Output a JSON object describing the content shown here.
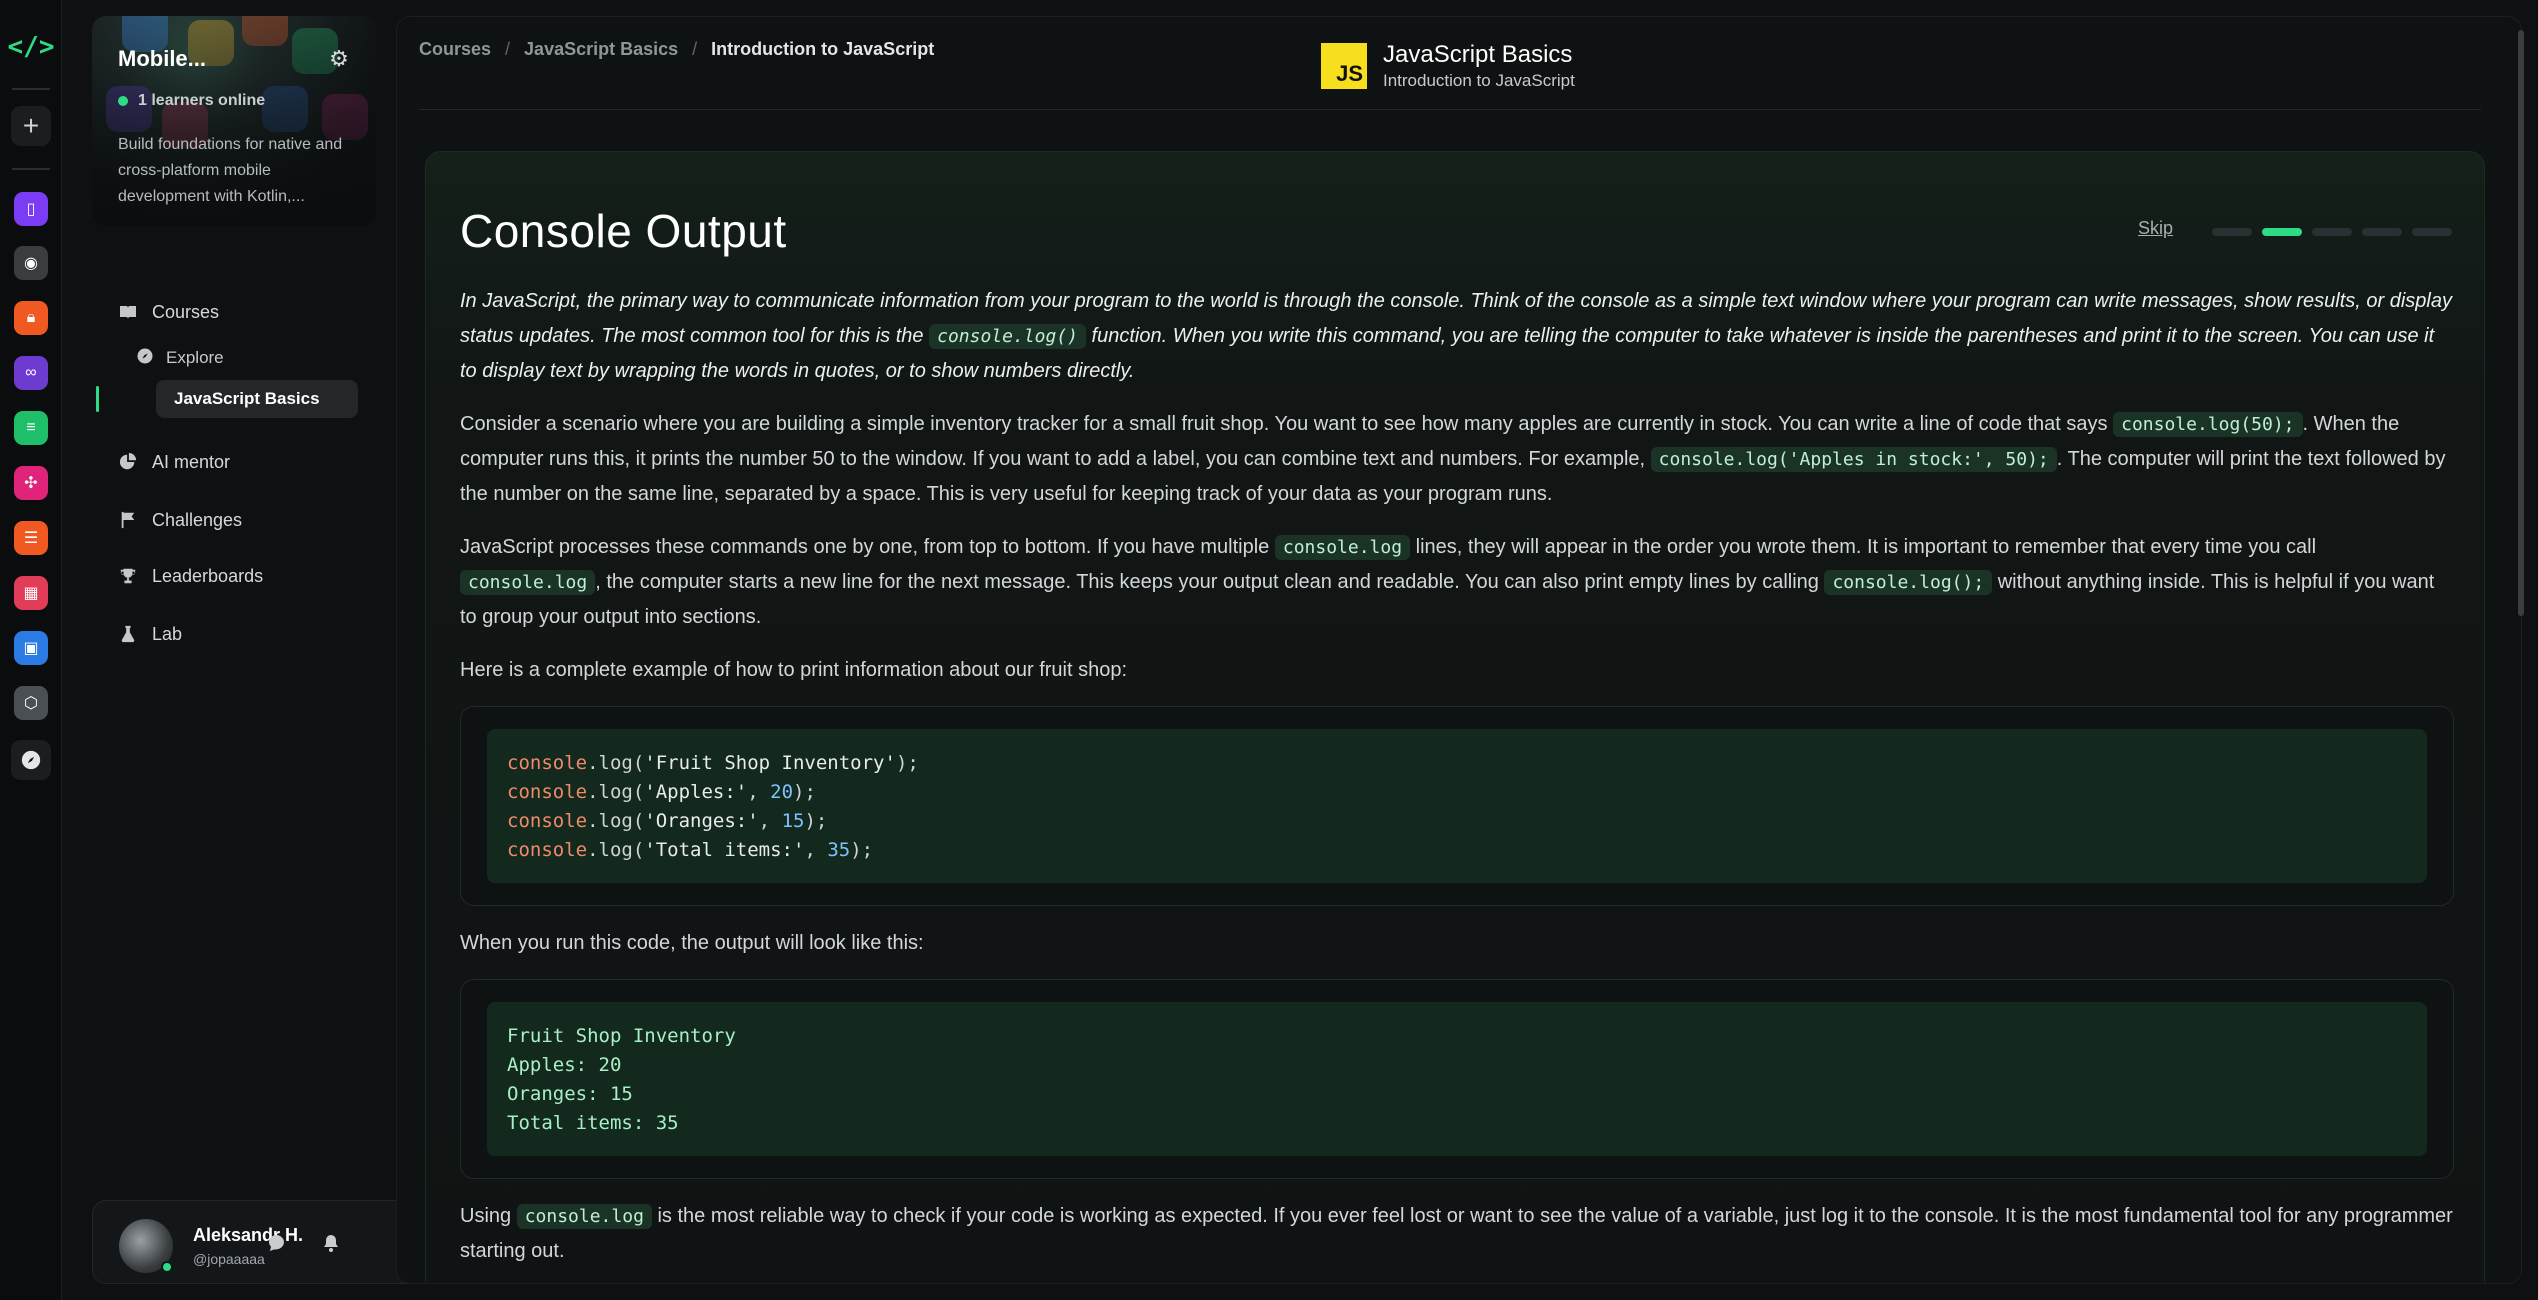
{
  "colors": {
    "accent": "#2fdc86",
    "js_badge": "#f7df1e"
  },
  "rail": {
    "icons": [
      "code-logo-icon",
      "plus-icon",
      "compass-icon"
    ],
    "apps": [
      {
        "name": "app-mobile",
        "color": "#7b3cf5"
      },
      {
        "name": "app-camera",
        "color": "#3a3d40"
      },
      {
        "name": "app-lock",
        "color": "#f05a22"
      },
      {
        "name": "app-infinity",
        "color": "#6e3bd1"
      },
      {
        "name": "app-database",
        "color": "#1fbf6a"
      },
      {
        "name": "app-network",
        "color": "#e0247a"
      },
      {
        "name": "app-stack",
        "color": "#f05a22"
      },
      {
        "name": "app-layout",
        "color": "#e23d58"
      },
      {
        "name": "app-window",
        "color": "#2a7be3"
      },
      {
        "name": "app-api",
        "color": "#4a4f53"
      }
    ]
  },
  "sidebar": {
    "hero": {
      "title": "Mobile...",
      "online": "1 learners online",
      "description": "Build foundations for native and cross-platform mobile development with Kotlin,..."
    },
    "nav": {
      "courses": "Courses",
      "explore": "Explore",
      "active_course": "JavaScript Basics",
      "ai_mentor": "AI mentor",
      "challenges": "Challenges",
      "leaderboards": "Leaderboards",
      "lab": "Lab"
    },
    "user": {
      "name": "Aleksandr H.",
      "handle": "@jopaaaaa"
    }
  },
  "header": {
    "breadcrumb": [
      "Courses",
      "JavaScript Basics",
      "Introduction to JavaScript"
    ],
    "badge": "JS",
    "course_title": "JavaScript Basics",
    "course_subtitle": "Introduction to JavaScript"
  },
  "lesson": {
    "title": "Console Output",
    "skip": "Skip",
    "steps_total": 5,
    "step_current": 2,
    "p1_a": "In JavaScript, the primary way to communicate information from your program to the world is through the console. Think of the console as a simple text window where your program can write messages, show results, or display status updates. The most common tool for this is the ",
    "p1_code": "console.log()",
    "p1_b": " function. When you write this command, you are telling the computer to take whatever is inside the parentheses and print it to the screen. You can use it to display text by wrapping the words in quotes, or to show numbers directly.",
    "p2_a": "Consider a scenario where you are building a simple inventory tracker for a small fruit shop. You want to see how many apples are currently in stock. You can write a line of code that says ",
    "p2_code1": "console.log(50);",
    "p2_b": ". When the computer runs this, it prints the number 50 to the window. If you want to add a label, you can combine text and numbers. For example, ",
    "p2_code2": "console.log('Apples in stock:', 50);",
    "p2_c": ". The computer will print the text followed by the number on the same line, separated by a space. This is very useful for keeping track of your data as your program runs.",
    "p3_a": "JavaScript processes these commands one by one, from top to bottom. If you have multiple ",
    "p3_code1": "console.log",
    "p3_b": " lines, they will appear in the order you wrote them. It is important to remember that every time you call ",
    "p3_code2": "console.log",
    "p3_c": ", the computer starts a new line for the next message. This keeps your output clean and readable. You can also print empty lines by calling ",
    "p3_code3": "console.log();",
    "p3_d": " without anything inside. This is helpful if you want to group your output into sections.",
    "p4": "Here is a complete example of how to print information about our fruit shop:",
    "code": [
      {
        "fn": "console",
        "method": ".log(",
        "str": "'Fruit Shop Inventory'",
        "num": "",
        "end": ");"
      },
      {
        "fn": "console",
        "method": ".log(",
        "str": "'Apples:'",
        "num": "20",
        "end": ");"
      },
      {
        "fn": "console",
        "method": ".log(",
        "str": "'Oranges:'",
        "num": "15",
        "end": ");"
      },
      {
        "fn": "console",
        "method": ".log(",
        "str": "'Total items:'",
        "num": "35",
        "end": ");"
      }
    ],
    "p5": "When you run this code, the output will look like this:",
    "output": [
      "Fruit Shop Inventory",
      "Apples: 20",
      "Oranges: 15",
      "Total items: 35"
    ],
    "p6_a": "Using ",
    "p6_code": "console.log",
    "p6_b": " is the most reliable way to check if your code is working as expected. If you ever feel lost or want to see the value of a variable, just log it to the console. It is the most fundamental tool for any programmer starting out."
  }
}
